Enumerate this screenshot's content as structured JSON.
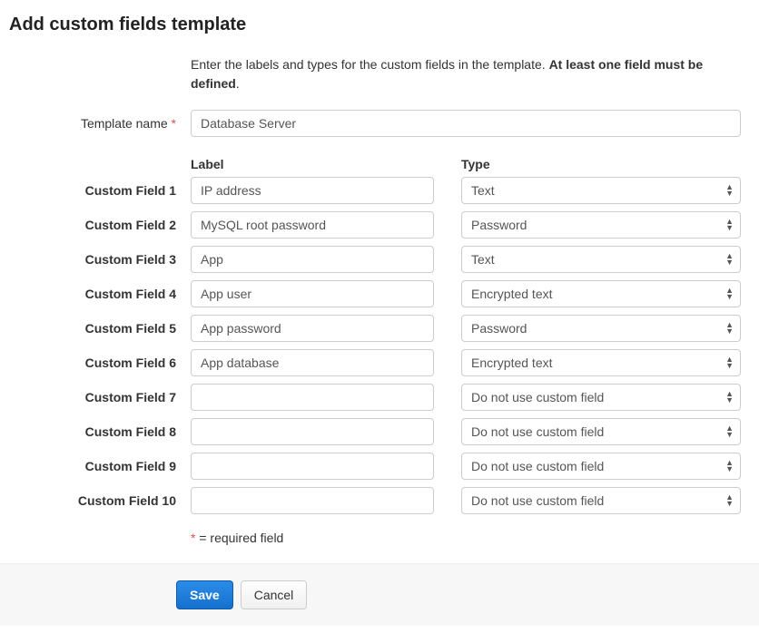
{
  "page_title": "Add custom fields template",
  "intro": {
    "prefix": "Enter the labels and types for the custom fields in the template. ",
    "bold": "At least one field must be defined",
    "suffix": "."
  },
  "template_name": {
    "label": "Template name",
    "required_marker": "*",
    "value": "Database Server"
  },
  "columns": {
    "label": "Label",
    "type": "Type"
  },
  "fields": [
    {
      "name": "Custom Field 1",
      "label_value": "IP address",
      "type_value": "Text"
    },
    {
      "name": "Custom Field 2",
      "label_value": "MySQL root password",
      "type_value": "Password"
    },
    {
      "name": "Custom Field 3",
      "label_value": "App",
      "type_value": "Text"
    },
    {
      "name": "Custom Field 4",
      "label_value": "App user",
      "type_value": "Encrypted text"
    },
    {
      "name": "Custom Field 5",
      "label_value": "App password",
      "type_value": "Password"
    },
    {
      "name": "Custom Field 6",
      "label_value": "App database",
      "type_value": "Encrypted text"
    },
    {
      "name": "Custom Field 7",
      "label_value": "",
      "type_value": "Do not use custom field"
    },
    {
      "name": "Custom Field 8",
      "label_value": "",
      "type_value": "Do not use custom field"
    },
    {
      "name": "Custom Field 9",
      "label_value": "",
      "type_value": "Do not use custom field"
    },
    {
      "name": "Custom Field 10",
      "label_value": "",
      "type_value": "Do not use custom field"
    }
  ],
  "required_note": {
    "marker": "*",
    "text": " = required field"
  },
  "buttons": {
    "save": "Save",
    "cancel": "Cancel"
  }
}
